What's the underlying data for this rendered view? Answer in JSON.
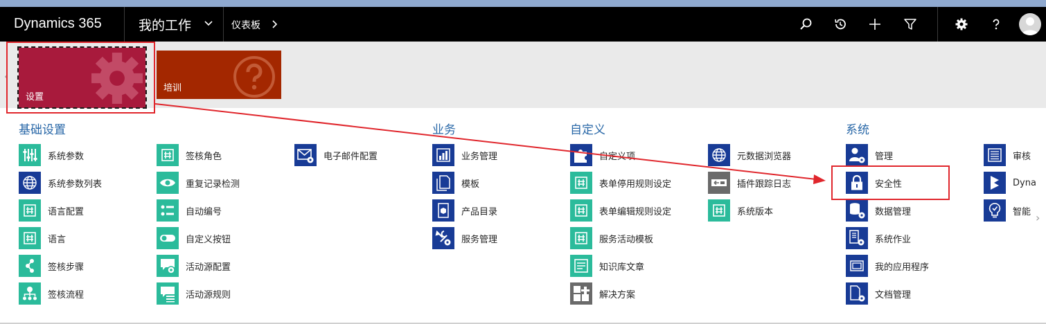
{
  "navbar": {
    "brand": "Dynamics 365",
    "area": "我的工作",
    "breadcrumb": "仪表板"
  },
  "tiles": [
    {
      "label": "设置",
      "color": "#a81a3c",
      "icon": "gear-icon"
    },
    {
      "label": "培训",
      "color": "#a32700",
      "icon": "question-icon"
    }
  ],
  "groups": {
    "basic": "基础设置",
    "business": "业务",
    "customize": "自定义",
    "system": "系统"
  },
  "items": {
    "sys_params": "系统参数",
    "sys_params_list": "系统参数列表",
    "lang_config": "语言配置",
    "language": "语言",
    "approval_steps": "签核步骤",
    "approval_flow": "签核流程",
    "approval_role": "签核角色",
    "dup_detect": "重复记录检测",
    "auto_number": "自动编号",
    "custom_button": "自定义按钮",
    "activity_config": "活动源配置",
    "activity_rules": "活动源规则",
    "email_config": "电子邮件配置",
    "biz_mgmt": "业务管理",
    "templates": "模板",
    "product_catalog": "产品目录",
    "service_mgmt": "服务管理",
    "customizations": "自定义项",
    "form_disable_rules": "表单停用规则设定",
    "form_edit_rules": "表单编辑规则设定",
    "service_activity_tpl": "服务活动模板",
    "kb_articles": "知识库文章",
    "solutions": "解决方案",
    "metadata_browser": "元数据浏览器",
    "plugin_trace": "插件跟踪日志",
    "sys_version": "系统版本",
    "administration": "管理",
    "security": "安全性",
    "data_mgmt": "数据管理",
    "sys_jobs": "系统作业",
    "my_apps": "我的应用程序",
    "doc_mgmt": "文档管理",
    "auditing": "审核",
    "dynamics_partial": "Dyna",
    "smart_partial": "智能"
  }
}
